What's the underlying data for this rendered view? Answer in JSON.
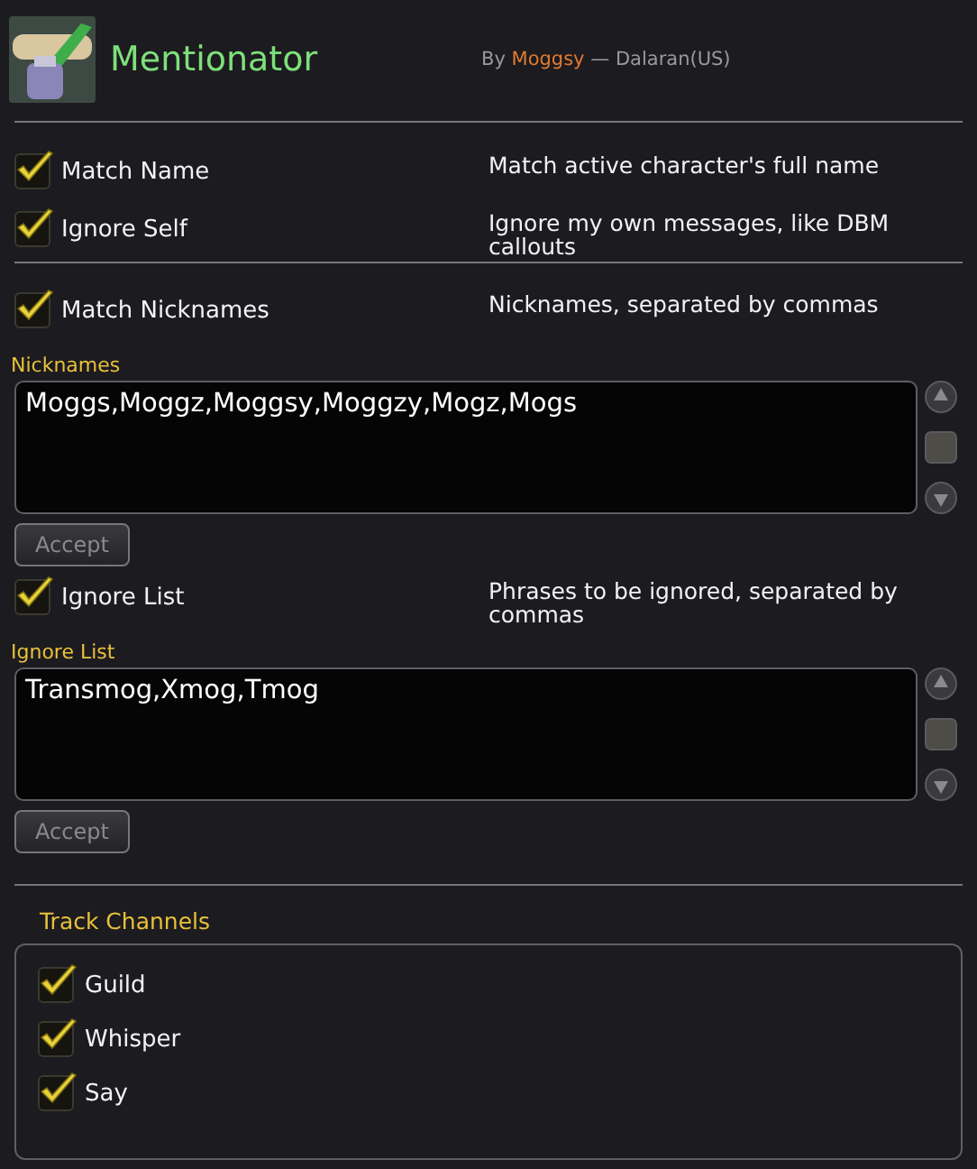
{
  "addon": {
    "title": "Mentionator",
    "by": "By",
    "author": "Moggsy",
    "realm": "— Dalaran(US)"
  },
  "general_options": [
    {
      "label": "Match Name",
      "checked": true,
      "description": "Match active character's full name"
    },
    {
      "label": "Ignore Self",
      "checked": true,
      "description": "Ignore my own messages, like DBM callouts"
    }
  ],
  "list_sections": [
    {
      "option": {
        "label": "Match Nicknames",
        "checked": true,
        "description": "Nicknames, separated by commas"
      },
      "field_label": "Nicknames",
      "value": "Moggs,Moggz,Moggsy,Moggzy,Mogz,Mogs",
      "button": "Accept"
    },
    {
      "option": {
        "label": "Ignore List",
        "checked": true,
        "description": "Phrases to be ignored, separated by commas"
      },
      "field_label": "Ignore List",
      "value": "Transmog,Xmog,Tmog",
      "button": "Accept"
    }
  ],
  "track_channels": {
    "title": "Track Channels",
    "channels": [
      {
        "label": "Guild",
        "checked": true
      },
      {
        "label": "Whisper",
        "checked": true
      },
      {
        "label": "Say",
        "checked": true
      }
    ]
  }
}
